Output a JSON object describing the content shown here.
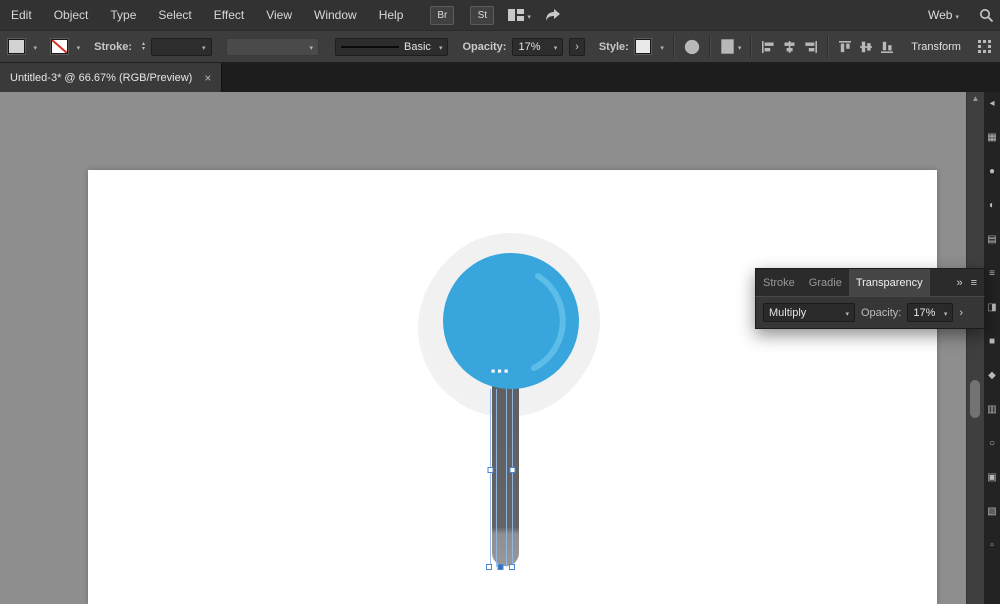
{
  "menubar": {
    "items": [
      "Edit",
      "Object",
      "Type",
      "Select",
      "Effect",
      "View",
      "Window",
      "Help"
    ],
    "app_icons": [
      {
        "label": "Br"
      },
      {
        "label": "St"
      }
    ],
    "workspace": "Web"
  },
  "controlbar": {
    "stroke_label": "Stroke:",
    "stroke_style": "Basic",
    "opacity_label": "Opacity:",
    "opacity_value": "17%",
    "style_label": "Style:",
    "transform_label": "Transform",
    "more_arrow": "›"
  },
  "document_tab": {
    "title": "Untitled-3* @ 66.67% (RGB/Preview)",
    "close": "×"
  },
  "transparency_panel": {
    "tabs": [
      "Stroke",
      "Gradie",
      "Transparency"
    ],
    "active_tab": "Transparency",
    "blend_mode": "Multiply",
    "opacity_label": "Opacity:",
    "opacity_value": "17%",
    "expand_icon": "»",
    "menu_icon": "≡",
    "more_arrow": "›"
  },
  "scrollbar": {
    "up_arrow": "▲"
  },
  "colors": {
    "ui_dark": "#323232",
    "canvas_bg": "#8e8e8e",
    "artboard": "#ffffff",
    "lollipop_blue": "#38a5dc",
    "lollipop_highlight": "#5bbde8",
    "lollipop_ring": "#f1f1f1",
    "stick_gray": "#616161",
    "stick_tip": "#8f8f8f",
    "selection_blue": "#93b7e8"
  }
}
